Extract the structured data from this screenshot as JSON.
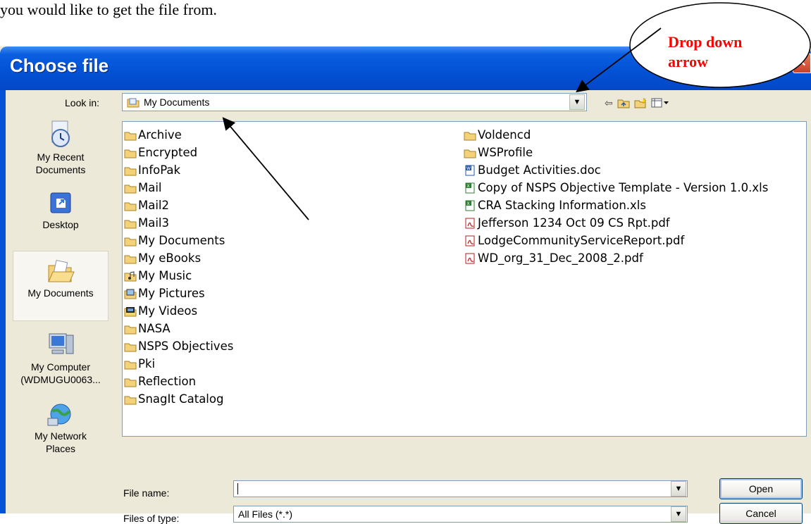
{
  "document": {
    "intro_text": "you would like to get the file from."
  },
  "dialog": {
    "title": "Choose file",
    "look_in_label": "Look in:",
    "look_in_value": "My Documents",
    "places": [
      {
        "label_line1": "My Recent",
        "label_line2": "Documents",
        "icon": "clock-documents-icon"
      },
      {
        "label_line1": "Desktop",
        "label_line2": "",
        "icon": "desktop-icon"
      },
      {
        "label_line1": "My Documents",
        "label_line2": "",
        "icon": "open-folder-icon",
        "selected": true
      },
      {
        "label_line1": "My Computer",
        "label_line2": "(WDMUGU0063...",
        "icon": "computer-icon"
      },
      {
        "label_line1": "My Network",
        "label_line2": "Places",
        "icon": "network-icon"
      }
    ],
    "files_left": [
      {
        "name": "Archive",
        "type": "folder"
      },
      {
        "name": "Encrypted",
        "type": "folder"
      },
      {
        "name": "InfoPak",
        "type": "folder"
      },
      {
        "name": "Mail",
        "type": "folder"
      },
      {
        "name": "Mail2",
        "type": "folder"
      },
      {
        "name": "Mail3",
        "type": "folder"
      },
      {
        "name": "My Documents",
        "type": "folder"
      },
      {
        "name": "My eBooks",
        "type": "folder"
      },
      {
        "name": "My Music",
        "type": "music-folder"
      },
      {
        "name": "My Pictures",
        "type": "pictures-folder"
      },
      {
        "name": "My Videos",
        "type": "videos-folder"
      },
      {
        "name": "NASA",
        "type": "folder"
      },
      {
        "name": "NSPS Objectives",
        "type": "folder"
      },
      {
        "name": "Pki",
        "type": "folder"
      },
      {
        "name": "Reflection",
        "type": "folder"
      },
      {
        "name": "SnagIt Catalog",
        "type": "folder"
      }
    ],
    "files_right": [
      {
        "name": "Voldencd",
        "type": "folder"
      },
      {
        "name": "WSProfile",
        "type": "folder"
      },
      {
        "name": "Budget Activities.doc",
        "type": "doc"
      },
      {
        "name": "Copy of NSPS Objective Template - Version 1.0.xls",
        "type": "xls"
      },
      {
        "name": "CRA Stacking Information.xls",
        "type": "xls"
      },
      {
        "name": "Jefferson 1234 Oct 09 CS Rpt.pdf",
        "type": "pdf"
      },
      {
        "name": "LodgeCommunityServiceReport.pdf",
        "type": "pdf"
      },
      {
        "name": "WD_org_31_Dec_2008_2.pdf",
        "type": "pdf"
      }
    ],
    "file_name_label": "File name:",
    "file_name_value": "",
    "files_of_type_label": "Files of type:",
    "files_of_type_value": "All Files (*.*)",
    "open_label": "Open",
    "cancel_label": "Cancel"
  },
  "annotation": {
    "callout_line1": "Drop down",
    "callout_line2": "arrow",
    "callout_color": "#ff0000"
  }
}
